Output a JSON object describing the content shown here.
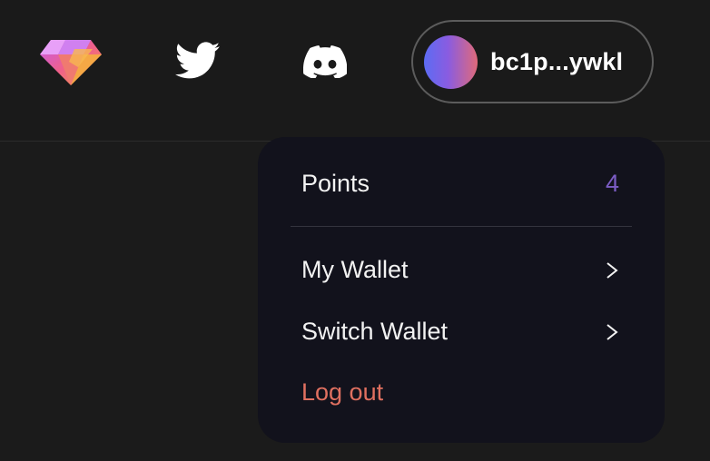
{
  "header": {
    "logo_icon": "gem-logo-icon",
    "twitter_icon": "twitter-icon",
    "discord_icon": "discord-icon",
    "wallet": {
      "address": "bc1p...ywkl",
      "avatar_gradient": [
        "#5c6cf4",
        "#8a5ce0",
        "#e06a7a"
      ]
    }
  },
  "menu": {
    "points_label": "Points",
    "points_value": "4",
    "my_wallet_label": "My Wallet",
    "switch_wallet_label": "Switch Wallet",
    "logout_label": "Log out"
  },
  "colors": {
    "background": "#1a1a1a",
    "dropdown_bg": "#12121c",
    "points_accent": "#7b5cc4",
    "logout": "#e07060"
  }
}
